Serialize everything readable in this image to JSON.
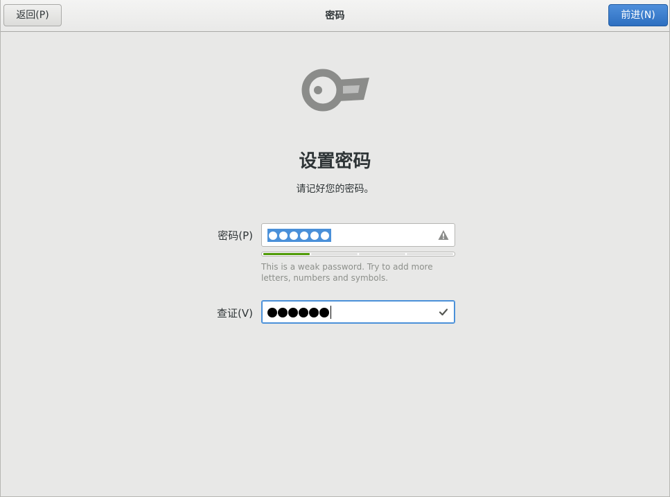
{
  "header": {
    "back_label": "返回(P)",
    "title": "密码",
    "next_label": "前进(N)"
  },
  "main": {
    "title": "设置密码",
    "subtitle": "请记好您的密码。"
  },
  "password_field": {
    "label": "密码(P)",
    "masked_char_count": 6,
    "selected": true,
    "status_icon": "warning-icon"
  },
  "strength": {
    "level": 1,
    "max_level": 4,
    "color": "#4e9a06"
  },
  "hint": "This is a weak password. Try to add more letters, numbers and symbols.",
  "verify_field": {
    "label": "查证(V)",
    "masked_char_count": 6,
    "status_icon": "checkmark-icon"
  },
  "colors": {
    "accent": "#4a90d9",
    "next_button": "#3a7fd0",
    "background": "#e8e8e7"
  }
}
